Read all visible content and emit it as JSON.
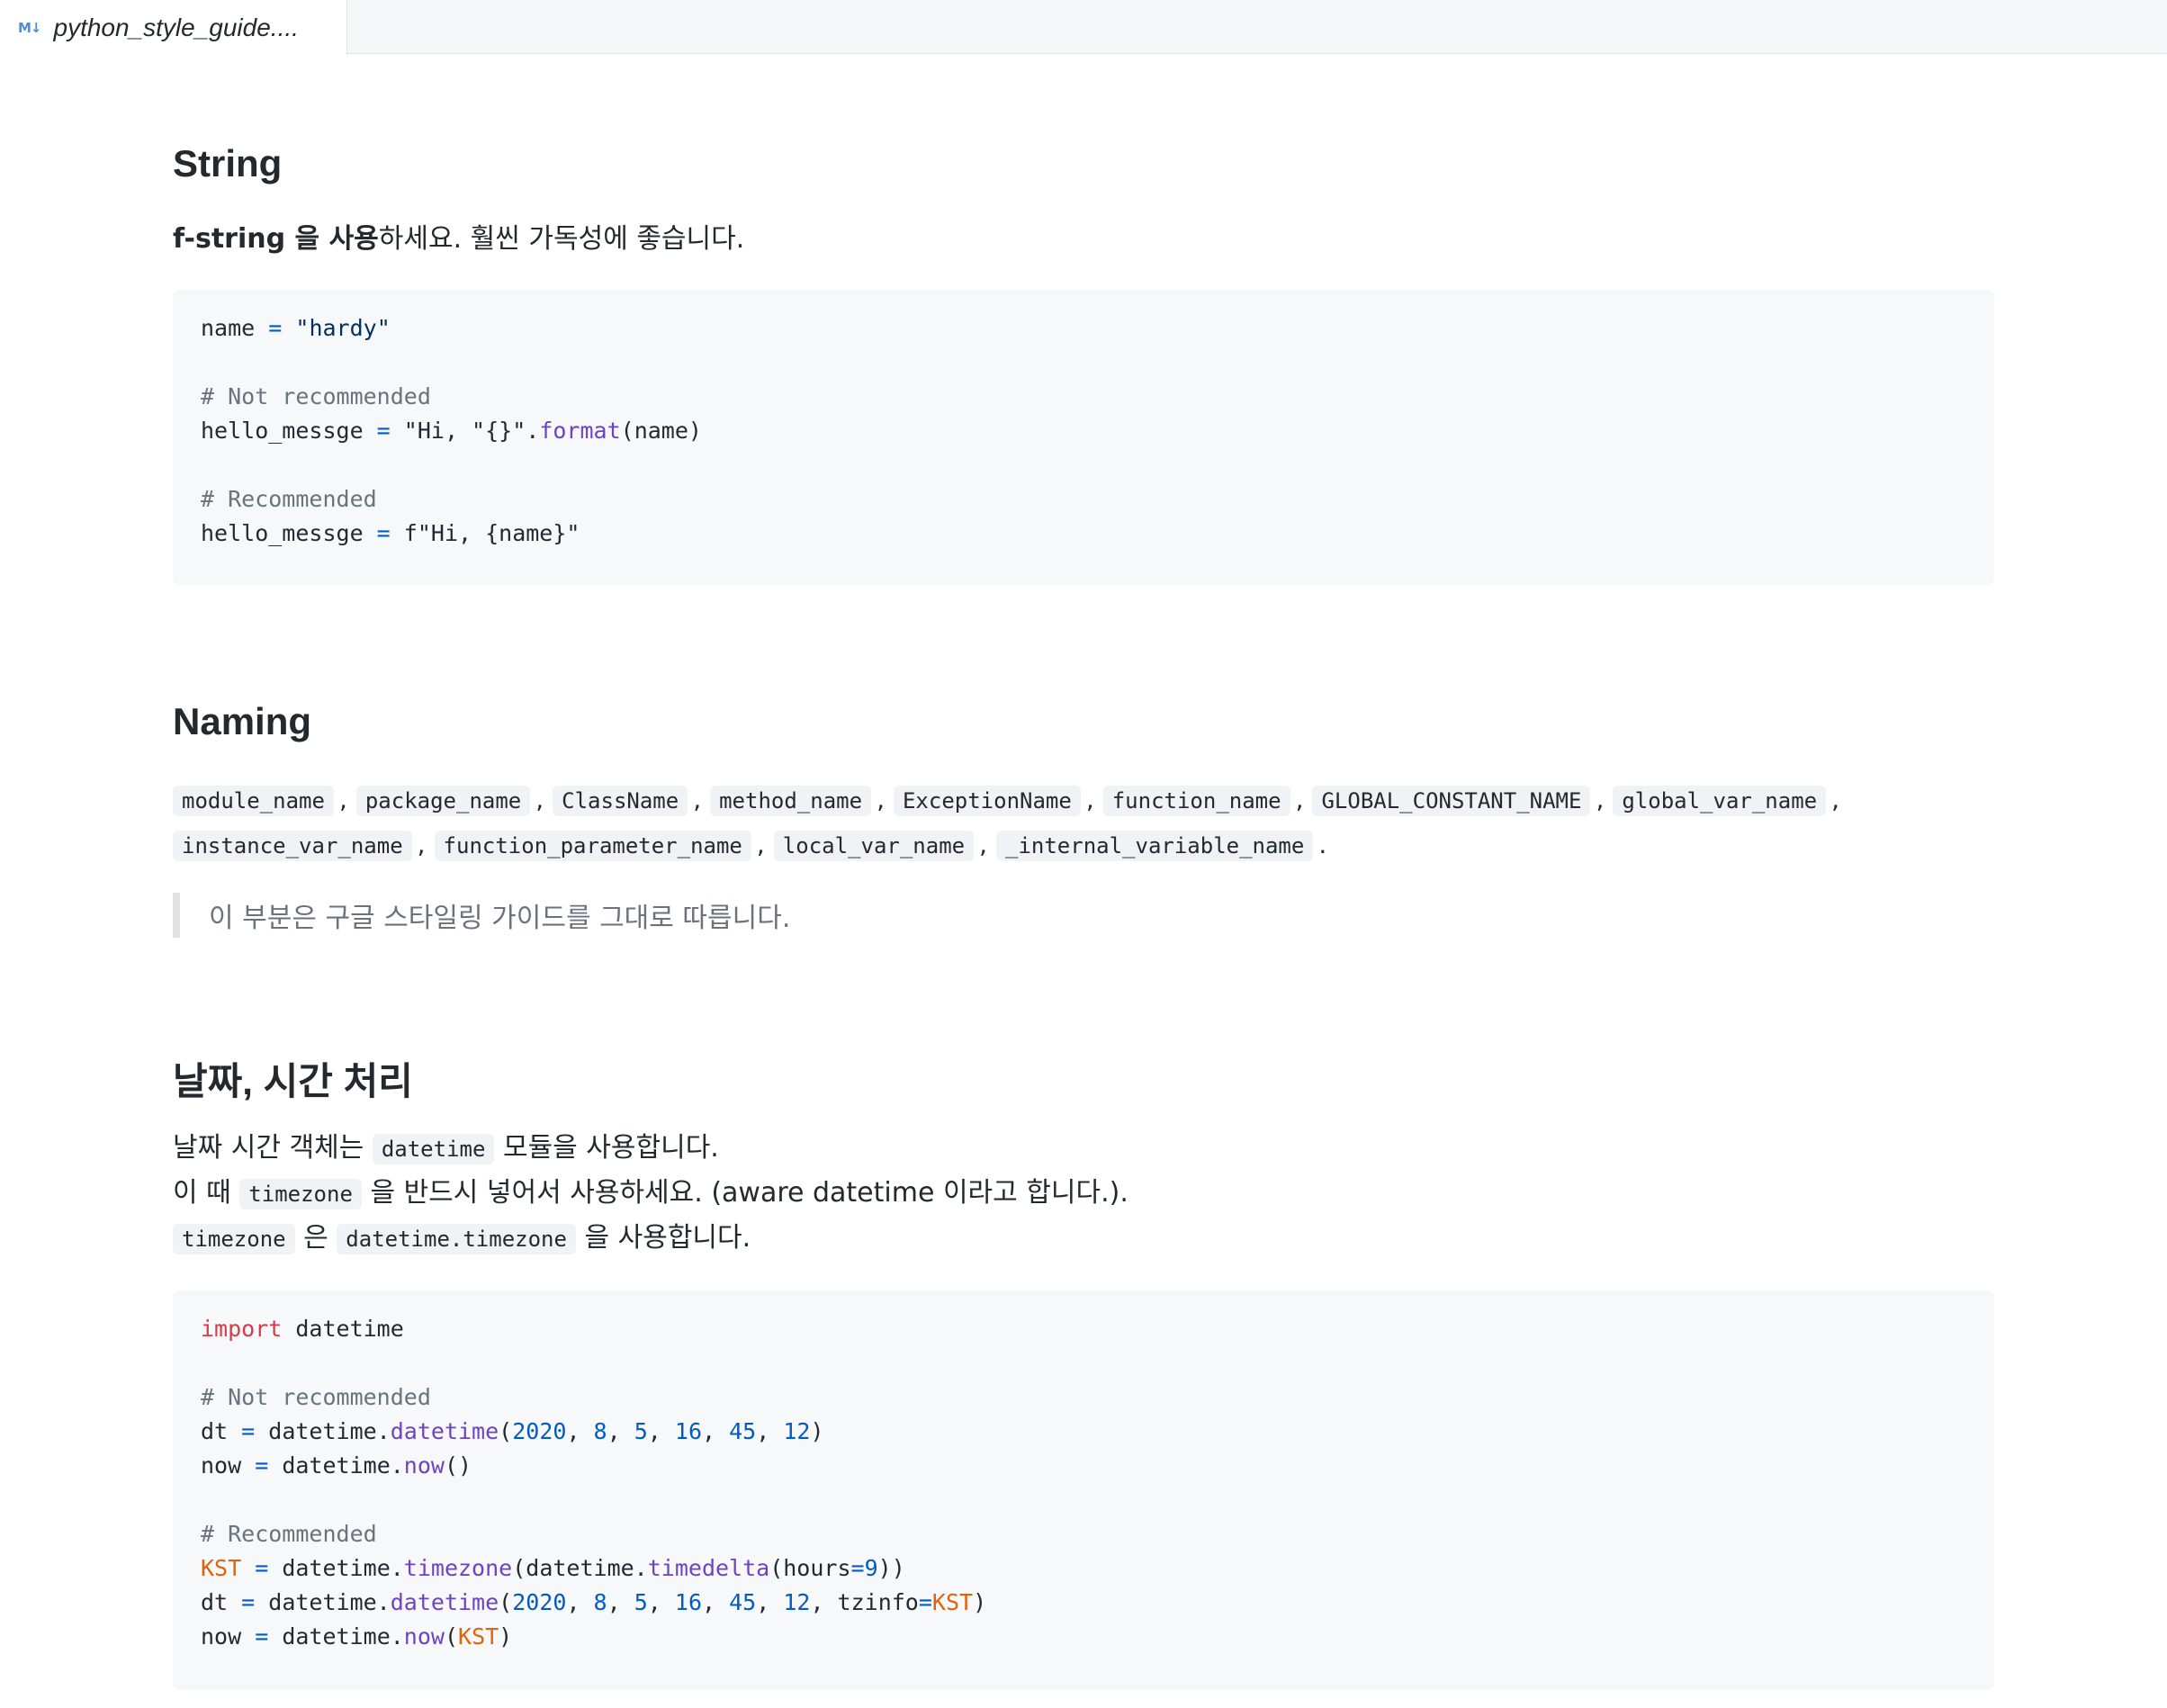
{
  "tab": {
    "title": "python_style_guide....",
    "icon": "M↓"
  },
  "string_section": {
    "title": "String",
    "intro_bold": "f-string 을 사용",
    "intro_rest": "하세요. 훨씬 가독성에 좋습니다.",
    "code": [
      [
        {
          "t": "name ",
          "c": ""
        },
        {
          "t": "=",
          "c": "op"
        },
        {
          "t": " ",
          "c": ""
        },
        {
          "t": "\"hardy\"",
          "c": "str"
        }
      ],
      [],
      [
        {
          "t": "# Not recommended",
          "c": "com"
        }
      ],
      [
        {
          "t": "hello_messge ",
          "c": ""
        },
        {
          "t": "=",
          "c": "op"
        },
        {
          "t": " ",
          "c": ""
        },
        {
          "t": "\"Hi, \"{}\"",
          "c": ""
        },
        {
          "t": ".",
          "c": ""
        },
        {
          "t": "format",
          "c": "fn"
        },
        {
          "t": "(name)",
          "c": ""
        }
      ],
      [],
      [
        {
          "t": "# Recommended",
          "c": "com"
        }
      ],
      [
        {
          "t": "hello_messge ",
          "c": ""
        },
        {
          "t": "=",
          "c": "op"
        },
        {
          "t": " ",
          "c": ""
        },
        {
          "t": "f\"Hi, {name}\"",
          "c": ""
        }
      ]
    ]
  },
  "naming_section": {
    "title": "Naming",
    "row1": [
      "module_name",
      "package_name",
      "ClassName",
      "method_name",
      "ExceptionName",
      "function_name",
      "GLOBAL_CONSTANT_NAME",
      "global_var_name"
    ],
    "row2": [
      "instance_var_name",
      "function_parameter_name",
      "local_var_name",
      "_internal_variable_name"
    ],
    "separator": ",",
    "end_mark": ".",
    "quote": "이 부분은 구글 스타일링 가이드를 그대로 따릅니다."
  },
  "datetime_section": {
    "title": "날짜, 시간 처리",
    "line1_pre": "날짜 시간 객체는",
    "line1_code": "datetime",
    "line1_post": "모듈을 사용합니다.",
    "line2_pre": "이 때",
    "line2_code": "timezone",
    "line2_post": "을 반드시 넣어서 사용하세요. (aware datetime 이라고 합니다.).",
    "line3_code1": "timezone",
    "line3_mid": "은",
    "line3_code2": "datetime.timezone",
    "line3_post": "을 사용합니다.",
    "code": [
      [
        {
          "t": "import",
          "c": "kw"
        },
        {
          "t": " datetime",
          "c": ""
        }
      ],
      [],
      [
        {
          "t": "# Not recommended",
          "c": "com"
        }
      ],
      [
        {
          "t": "dt ",
          "c": ""
        },
        {
          "t": "=",
          "c": "op"
        },
        {
          "t": " datetime.",
          "c": ""
        },
        {
          "t": "datetime",
          "c": "fn"
        },
        {
          "t": "(",
          "c": ""
        },
        {
          "t": "2020",
          "c": "num"
        },
        {
          "t": ", ",
          "c": ""
        },
        {
          "t": "8",
          "c": "num"
        },
        {
          "t": ", ",
          "c": ""
        },
        {
          "t": "5",
          "c": "num"
        },
        {
          "t": ", ",
          "c": ""
        },
        {
          "t": "16",
          "c": "num"
        },
        {
          "t": ", ",
          "c": ""
        },
        {
          "t": "45",
          "c": "num"
        },
        {
          "t": ", ",
          "c": ""
        },
        {
          "t": "12",
          "c": "num"
        },
        {
          "t": ")",
          "c": ""
        }
      ],
      [
        {
          "t": "now ",
          "c": ""
        },
        {
          "t": "=",
          "c": "op"
        },
        {
          "t": " datetime.",
          "c": ""
        },
        {
          "t": "now",
          "c": "fn"
        },
        {
          "t": "()",
          "c": ""
        }
      ],
      [],
      [
        {
          "t": "# Recommended",
          "c": "com"
        }
      ],
      [
        {
          "t": "KST",
          "c": "const"
        },
        {
          "t": " ",
          "c": ""
        },
        {
          "t": "=",
          "c": "op"
        },
        {
          "t": " datetime.",
          "c": ""
        },
        {
          "t": "timezone",
          "c": "fn"
        },
        {
          "t": "(datetime.",
          "c": ""
        },
        {
          "t": "timedelta",
          "c": "fn"
        },
        {
          "t": "(hours",
          "c": ""
        },
        {
          "t": "=",
          "c": "op"
        },
        {
          "t": "9",
          "c": "num"
        },
        {
          "t": "))",
          "c": ""
        }
      ],
      [
        {
          "t": "dt ",
          "c": ""
        },
        {
          "t": "=",
          "c": "op"
        },
        {
          "t": " datetime.",
          "c": ""
        },
        {
          "t": "datetime",
          "c": "fn"
        },
        {
          "t": "(",
          "c": ""
        },
        {
          "t": "2020",
          "c": "num"
        },
        {
          "t": ", ",
          "c": ""
        },
        {
          "t": "8",
          "c": "num"
        },
        {
          "t": ", ",
          "c": ""
        },
        {
          "t": "5",
          "c": "num"
        },
        {
          "t": ", ",
          "c": ""
        },
        {
          "t": "16",
          "c": "num"
        },
        {
          "t": ", ",
          "c": ""
        },
        {
          "t": "45",
          "c": "num"
        },
        {
          "t": ", ",
          "c": ""
        },
        {
          "t": "12",
          "c": "num"
        },
        {
          "t": ", tzinfo",
          "c": ""
        },
        {
          "t": "=",
          "c": "op"
        },
        {
          "t": "KST",
          "c": "const"
        },
        {
          "t": ")",
          "c": ""
        }
      ],
      [
        {
          "t": "now ",
          "c": ""
        },
        {
          "t": "=",
          "c": "op"
        },
        {
          "t": " datetime.",
          "c": ""
        },
        {
          "t": "now",
          "c": "fn"
        },
        {
          "t": "(",
          "c": ""
        },
        {
          "t": "KST",
          "c": "const"
        },
        {
          "t": ")",
          "c": ""
        }
      ]
    ]
  },
  "syntax_colors": {
    "string": "#032f62",
    "comment": "#6a737d",
    "operator": "#005cc5",
    "function": "#6f42c1",
    "number": "#005cc5",
    "keyword": "#d73a49",
    "constant": "#e36209"
  }
}
